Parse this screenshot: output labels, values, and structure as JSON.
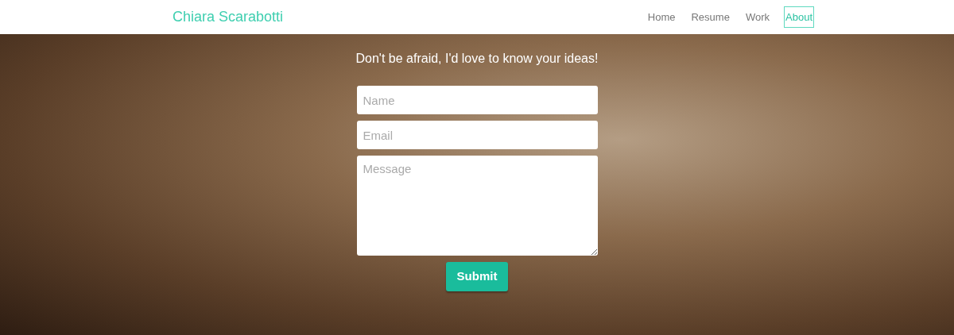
{
  "brand": "Chiara Scarabotti",
  "nav": [
    {
      "label": "Home",
      "selected": false
    },
    {
      "label": "Resume",
      "selected": false
    },
    {
      "label": "Work",
      "selected": false
    },
    {
      "label": "About",
      "selected": true
    }
  ],
  "contact": {
    "heading": "Don't be afraid, I'd love to know your ideas!",
    "fields": [
      {
        "kind": "input",
        "placeholder": "Name"
      },
      {
        "kind": "input",
        "placeholder": "Email"
      },
      {
        "kind": "textarea",
        "placeholder": "Message"
      }
    ],
    "submit": "Submit"
  }
}
